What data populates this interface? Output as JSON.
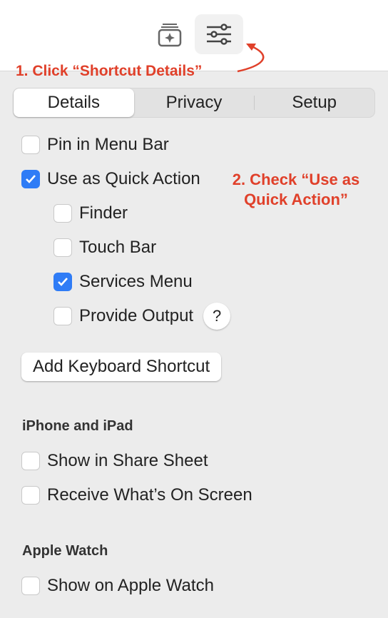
{
  "toolbar": {
    "buttons": [
      {
        "icon": "shortcut-library-icon"
      },
      {
        "icon": "sliders-icon",
        "active": true
      }
    ]
  },
  "annotations": {
    "step1": "1. Click “Shortcut Details”",
    "step2_line1": "2. Check “Use as",
    "step2_line2": "Quick Action”",
    "color": "#e0402a"
  },
  "tabs": [
    {
      "label": "Details",
      "selected": true
    },
    {
      "label": "Privacy"
    },
    {
      "label": "Setup"
    }
  ],
  "options": [
    {
      "label": "Pin in Menu Bar",
      "checked": false
    },
    {
      "label": "Use as Quick Action",
      "checked": true
    },
    {
      "label": "Finder",
      "checked": false
    },
    {
      "label": "Touch Bar",
      "checked": false
    },
    {
      "label": "Services Menu",
      "checked": true
    },
    {
      "label": "Provide Output",
      "checked": false
    }
  ],
  "help_label": "?",
  "add_shortcut_label": "Add Keyboard Shortcut",
  "iphone": {
    "header": "iPhone and iPad",
    "options": [
      {
        "label": "Show in Share Sheet",
        "checked": false
      },
      {
        "label": "Receive What’s On Screen",
        "checked": false
      }
    ]
  },
  "watch": {
    "header": "Apple Watch",
    "options": [
      {
        "label": "Show on Apple Watch",
        "checked": false
      }
    ]
  },
  "accent": "#2f7cf6"
}
